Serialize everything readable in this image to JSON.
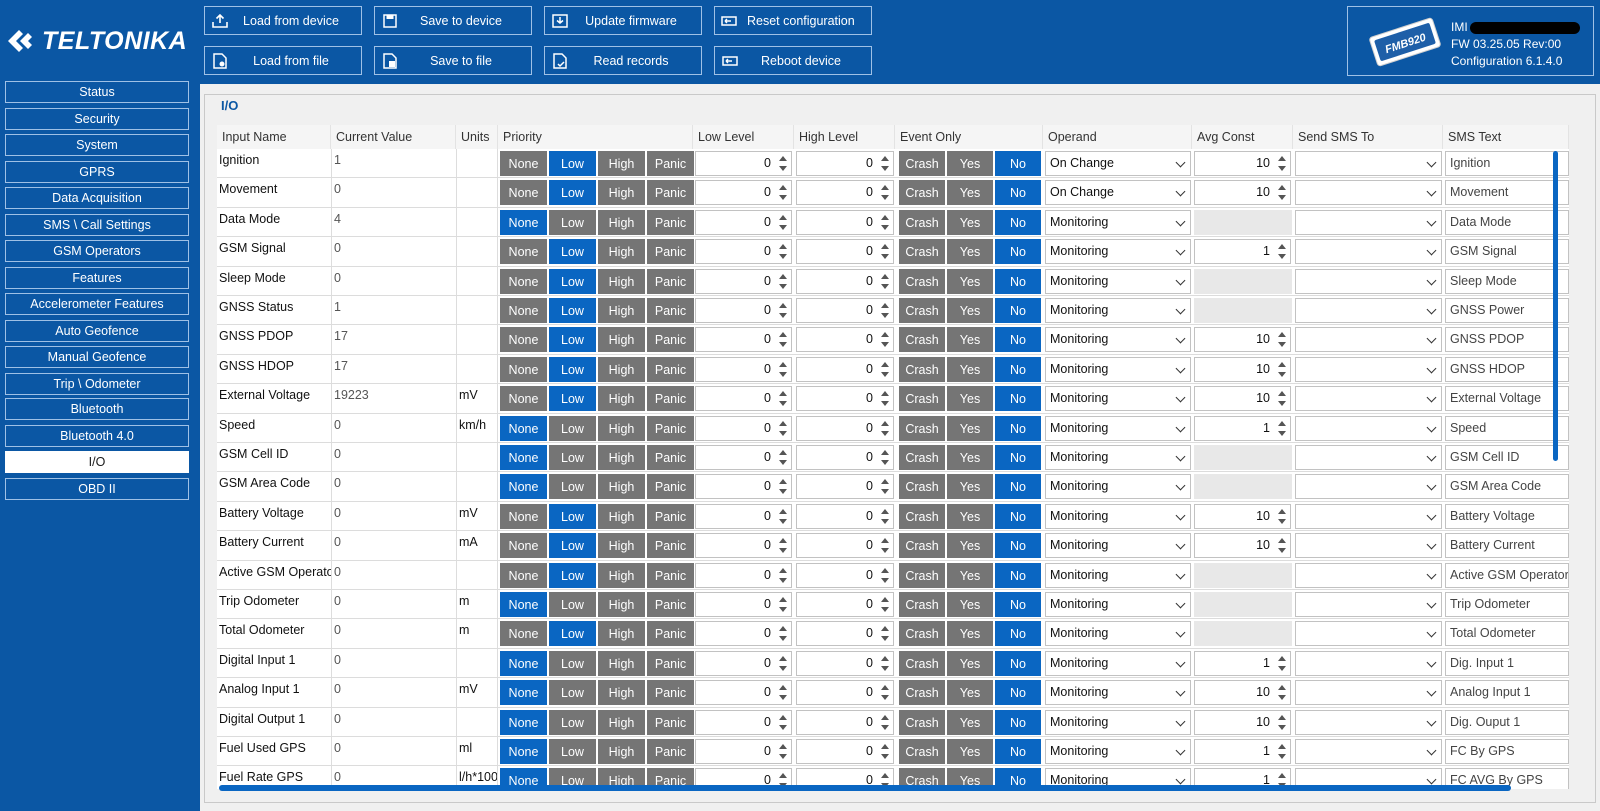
{
  "app": {
    "brand": "TELTONIKA"
  },
  "toolbar": {
    "load_device": "Load from device",
    "save_device": "Save to device",
    "update_firmware": "Update firmware",
    "reset_config": "Reset configuration",
    "load_file": "Load from file",
    "save_file": "Save to file",
    "read_records": "Read records",
    "reboot": "Reboot device"
  },
  "device": {
    "model": "FMB920",
    "imei_label": "IMI",
    "fw": "FW  03.25.05 Rev:00",
    "config": "Configuration  6.1.4.0"
  },
  "sidebar": {
    "items": [
      "Status",
      "Security",
      "System",
      "GPRS",
      "Data Acquisition",
      "SMS \\ Call Settings",
      "GSM Operators",
      "Features",
      "Accelerometer Features",
      "Auto Geofence",
      "Manual Geofence",
      "Trip \\ Odometer",
      "Bluetooth",
      "Bluetooth 4.0",
      "I/O",
      "OBD II"
    ],
    "active": "I/O"
  },
  "section": {
    "title": "I/O"
  },
  "columns": {
    "input_name": "Input Name",
    "current_value": "Current Value",
    "units": "Units",
    "priority": "Priority",
    "low_level": "Low Level",
    "high_level": "High Level",
    "event_only": "Event Only",
    "operand": "Operand",
    "avg_const": "Avg Const",
    "send_sms_to": "Send SMS To",
    "sms_text": "SMS Text"
  },
  "priority_options": [
    "None",
    "Low",
    "High",
    "Panic"
  ],
  "event_options": [
    "Crash",
    "Yes",
    "No"
  ],
  "rows": [
    {
      "name": "Ignition",
      "value": "1",
      "units": "",
      "priority": "Low",
      "low": "0",
      "high": "0",
      "event": "No",
      "operand": "On Change",
      "avg": "10",
      "sms": "",
      "text": "Ignition"
    },
    {
      "name": "Movement",
      "value": "0",
      "units": "",
      "priority": "Low",
      "low": "0",
      "high": "0",
      "event": "No",
      "operand": "On Change",
      "avg": "10",
      "sms": "",
      "text": "Movement"
    },
    {
      "name": "Data Mode",
      "value": "4",
      "units": "",
      "priority": "None",
      "low": "0",
      "high": "0",
      "event": "No",
      "operand": "Monitoring",
      "avg": "",
      "sms": "",
      "text": "Data Mode"
    },
    {
      "name": "GSM Signal",
      "value": "0",
      "units": "",
      "priority": "Low",
      "low": "0",
      "high": "0",
      "event": "No",
      "operand": "Monitoring",
      "avg": "1",
      "sms": "",
      "text": "GSM Signal"
    },
    {
      "name": "Sleep Mode",
      "value": "0",
      "units": "",
      "priority": "Low",
      "low": "0",
      "high": "0",
      "event": "No",
      "operand": "Monitoring",
      "avg": "",
      "sms": "",
      "text": "Sleep Mode"
    },
    {
      "name": "GNSS Status",
      "value": "1",
      "units": "",
      "priority": "Low",
      "low": "0",
      "high": "0",
      "event": "No",
      "operand": "Monitoring",
      "avg": "",
      "sms": "",
      "text": "GNSS Power"
    },
    {
      "name": "GNSS PDOP",
      "value": "17",
      "units": "",
      "priority": "Low",
      "low": "0",
      "high": "0",
      "event": "No",
      "operand": "Monitoring",
      "avg": "10",
      "sms": "",
      "text": "GNSS PDOP"
    },
    {
      "name": "GNSS HDOP",
      "value": "17",
      "units": "",
      "priority": "Low",
      "low": "0",
      "high": "0",
      "event": "No",
      "operand": "Monitoring",
      "avg": "10",
      "sms": "",
      "text": "GNSS HDOP"
    },
    {
      "name": "External Voltage",
      "value": "19223",
      "units": "mV",
      "priority": "Low",
      "low": "0",
      "high": "0",
      "event": "No",
      "operand": "Monitoring",
      "avg": "10",
      "sms": "",
      "text": "External Voltage"
    },
    {
      "name": "Speed",
      "value": "0",
      "units": "km/h",
      "priority": "None",
      "low": "0",
      "high": "0",
      "event": "No",
      "operand": "Monitoring",
      "avg": "1",
      "sms": "",
      "text": "Speed"
    },
    {
      "name": "GSM Cell ID",
      "value": "0",
      "units": "",
      "priority": "None",
      "low": "0",
      "high": "0",
      "event": "No",
      "operand": "Monitoring",
      "avg": "",
      "sms": "",
      "text": "GSM Cell ID"
    },
    {
      "name": "GSM Area Code",
      "value": "0",
      "units": "",
      "priority": "None",
      "low": "0",
      "high": "0",
      "event": "No",
      "operand": "Monitoring",
      "avg": "",
      "sms": "",
      "text": "GSM Area Code"
    },
    {
      "name": "Battery Voltage",
      "value": "0",
      "units": "mV",
      "priority": "Low",
      "low": "0",
      "high": "0",
      "event": "No",
      "operand": "Monitoring",
      "avg": "10",
      "sms": "",
      "text": "Battery Voltage"
    },
    {
      "name": "Battery Current",
      "value": "0",
      "units": "mA",
      "priority": "Low",
      "low": "0",
      "high": "0",
      "event": "No",
      "operand": "Monitoring",
      "avg": "10",
      "sms": "",
      "text": "Battery Current"
    },
    {
      "name": "Active GSM Operator",
      "value": "0",
      "units": "",
      "priority": "Low",
      "low": "0",
      "high": "0",
      "event": "No",
      "operand": "Monitoring",
      "avg": "",
      "sms": "",
      "text": "Active GSM Operator"
    },
    {
      "name": "Trip Odometer",
      "value": "0",
      "units": "m",
      "priority": "None",
      "low": "0",
      "high": "0",
      "event": "No",
      "operand": "Monitoring",
      "avg": "",
      "sms": "",
      "text": "Trip Odometer"
    },
    {
      "name": "Total Odometer",
      "value": "0",
      "units": "m",
      "priority": "Low",
      "low": "0",
      "high": "0",
      "event": "No",
      "operand": "Monitoring",
      "avg": "",
      "sms": "",
      "text": "Total Odometer"
    },
    {
      "name": "Digital Input 1",
      "value": "0",
      "units": "",
      "priority": "None",
      "low": "0",
      "high": "0",
      "event": "No",
      "operand": "Monitoring",
      "avg": "1",
      "sms": "",
      "text": "Dig. Input 1"
    },
    {
      "name": "Analog Input 1",
      "value": "0",
      "units": "mV",
      "priority": "None",
      "low": "0",
      "high": "0",
      "event": "No",
      "operand": "Monitoring",
      "avg": "10",
      "sms": "",
      "text": "Analog Input 1"
    },
    {
      "name": "Digital Output 1",
      "value": "0",
      "units": "",
      "priority": "None",
      "low": "0",
      "high": "0",
      "event": "No",
      "operand": "Monitoring",
      "avg": "10",
      "sms": "",
      "text": "Dig. Ouput 1"
    },
    {
      "name": "Fuel Used GPS",
      "value": "0",
      "units": "ml",
      "priority": "None",
      "low": "0",
      "high": "0",
      "event": "No",
      "operand": "Monitoring",
      "avg": "1",
      "sms": "",
      "text": "FC By GPS"
    },
    {
      "name": "Fuel Rate GPS",
      "value": "0",
      "units": "l/h*100",
      "priority": "None",
      "low": "0",
      "high": "0",
      "event": "No",
      "operand": "Monitoring",
      "avg": "1",
      "sms": "",
      "text": "FC AVG By GPS"
    }
  ],
  "colors": {
    "brand": "#0b57a4",
    "selected": "#0a66c2",
    "unselected": "#757575"
  }
}
